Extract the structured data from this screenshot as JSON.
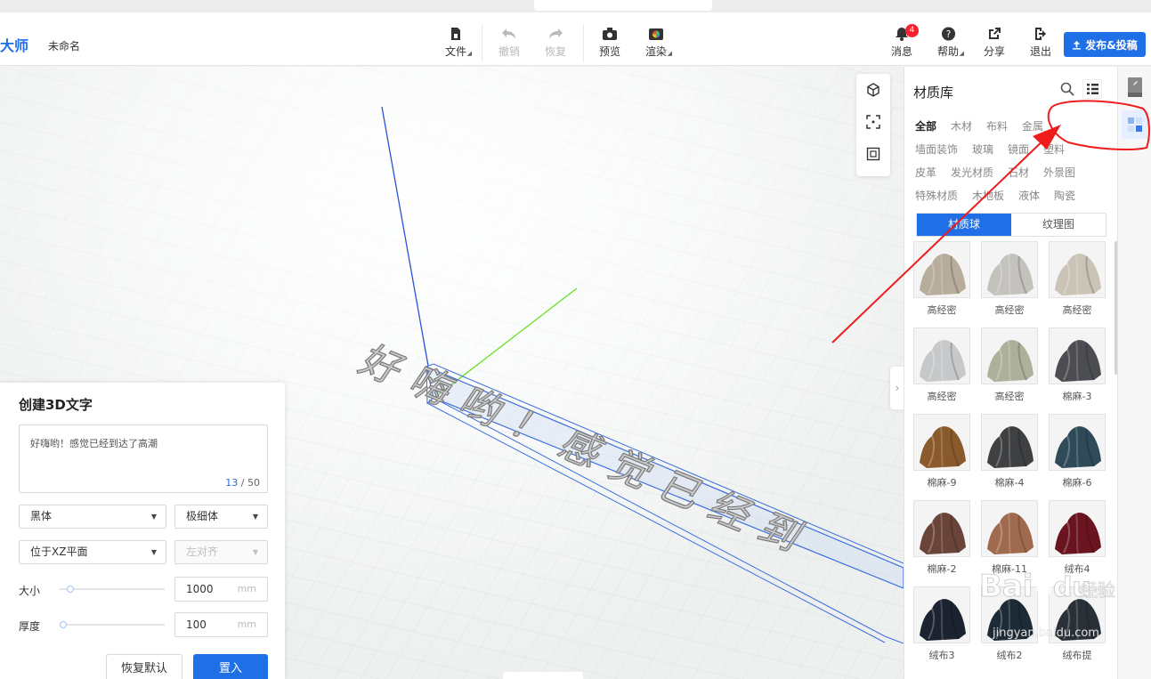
{
  "header": {
    "brand": "大师",
    "doc_name": "未命名",
    "tools": {
      "file": "文件",
      "undo": "撤销",
      "redo": "恢复",
      "preview": "预览",
      "render": "渲染"
    },
    "right_tools": {
      "notify": "消息",
      "notify_count": "4",
      "help": "帮助",
      "share": "分享",
      "logout": "退出"
    },
    "publish_label": "发布&投稿"
  },
  "text_panel": {
    "title": "创建3D文字",
    "text_value": "好嗨哟！感觉已经到达了高潮",
    "count_current": "13",
    "count_max": "/ 50",
    "font_family": "黑体",
    "font_weight": "极细体",
    "plane": "位于XZ平面",
    "align": "左对齐",
    "size_label": "大小",
    "size_value": "1000",
    "size_unit": "mm",
    "size_level": 0.1,
    "thickness_label": "厚度",
    "thickness_value": "100",
    "thickness_unit": "mm",
    "thickness_level": 0.03,
    "reset_label": "恢复默认",
    "place_label": "置入"
  },
  "scene": {
    "text_glyphs": [
      "好",
      "嗨",
      "哟",
      "！",
      "感",
      "觉",
      "已",
      "经",
      "到"
    ],
    "axis_colors": {
      "z": "#2a52d6",
      "y": "#68e028",
      "box": "#3b6fe0"
    }
  },
  "material_panel": {
    "title": "材质库",
    "categories": [
      {
        "label": "全部",
        "active": true
      },
      {
        "label": "木材"
      },
      {
        "label": "布料"
      },
      {
        "label": "金属"
      },
      {
        "label": "墙面装饰"
      },
      {
        "label": "玻璃"
      },
      {
        "label": "镜面"
      },
      {
        "label": "塑料"
      },
      {
        "label": "皮革"
      },
      {
        "label": "发光材质"
      },
      {
        "label": "石材"
      },
      {
        "label": "外景图"
      },
      {
        "label": "特殊材质"
      },
      {
        "label": "木地板"
      },
      {
        "label": "液体"
      },
      {
        "label": "陶瓷"
      }
    ],
    "tabs": [
      "材质球",
      "纹理图"
    ],
    "items": [
      {
        "name": "高经密",
        "color": "#b8ad9c"
      },
      {
        "name": "高经密",
        "color": "#c4c2bd"
      },
      {
        "name": "高经密",
        "color": "#c9c4b5"
      },
      {
        "name": "高经密",
        "color": "#c6c8ca"
      },
      {
        "name": "高经密",
        "color": "#aeb09a"
      },
      {
        "name": "棉麻-3",
        "color": "#4c4d52"
      },
      {
        "name": "棉麻-9",
        "color": "#8a5a2c"
      },
      {
        "name": "棉麻-4",
        "color": "#3f4042"
      },
      {
        "name": "棉麻-6",
        "color": "#2f4a58"
      },
      {
        "name": "棉麻-2",
        "color": "#6a4438"
      },
      {
        "name": "棉麻-11",
        "color": "#a06a4e"
      },
      {
        "name": "绒布4",
        "color": "#6a1420"
      },
      {
        "name": "绒布3",
        "color": "#1b2230"
      },
      {
        "name": "绒布2",
        "color": "#1d2b36"
      },
      {
        "name": "绒布提",
        "color": "#2a3038"
      }
    ]
  },
  "watermark": {
    "brand": "Bai",
    "brand2": "du",
    "site": "经验",
    "url": "jingyan.baidu.com"
  }
}
